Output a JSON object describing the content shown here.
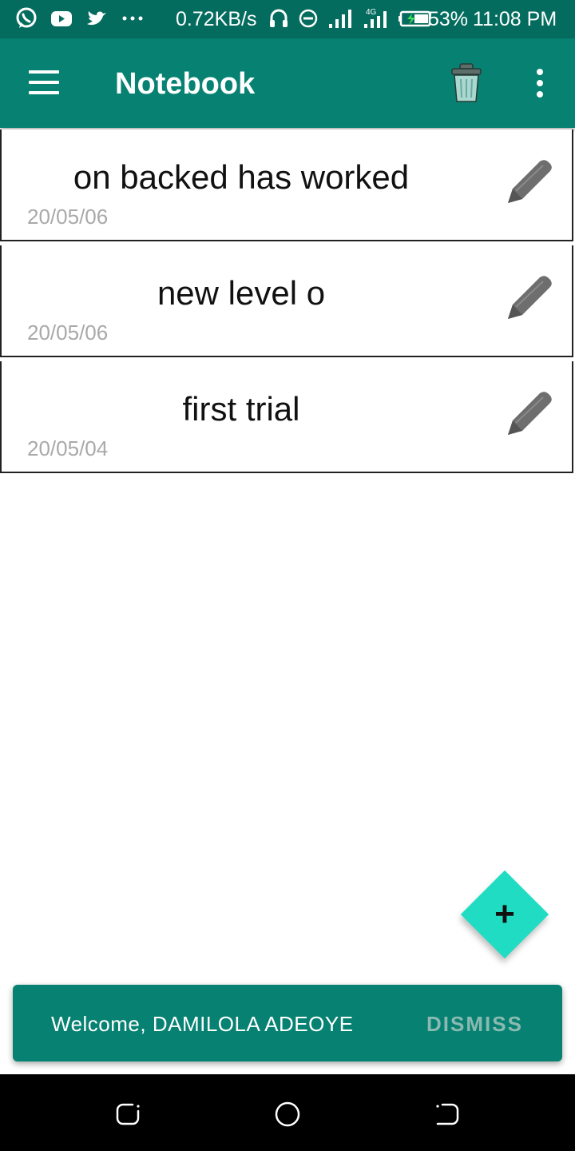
{
  "status_bar": {
    "net_speed": "0.72KB/s",
    "network_type": "4G",
    "battery": "53%",
    "time": "11:08 PM",
    "icons": [
      "whatsapp-icon",
      "youtube-icon",
      "twitter-icon",
      "more-notifications-icon",
      "headset-icon",
      "dnd-icon",
      "signal-icon",
      "signal-4g-icon",
      "battery-icon"
    ]
  },
  "app_bar": {
    "title": "Notebook",
    "icons": [
      "menu-icon",
      "trash-icon",
      "more-vert-icon"
    ]
  },
  "notes": [
    {
      "title": "on backed has worked",
      "date": "20/05/06"
    },
    {
      "title": "new level o",
      "date": "20/05/06"
    },
    {
      "title": "first trial",
      "date": "20/05/04"
    }
  ],
  "fab": {
    "label": "+"
  },
  "snackbar": {
    "message": "Welcome, DAMILOLA ADEOYE",
    "action": "DISMISS"
  },
  "nav_bar": {
    "icons": [
      "recents-icon",
      "home-icon",
      "back-icon"
    ]
  },
  "colors": {
    "status_bar": "#046c5e",
    "primary": "#078272",
    "accent": "#1fdcc3",
    "date_text": "#a9a9a9",
    "icon_gray": "#6e6e6e",
    "trash_fill": "#a8d8cf"
  }
}
